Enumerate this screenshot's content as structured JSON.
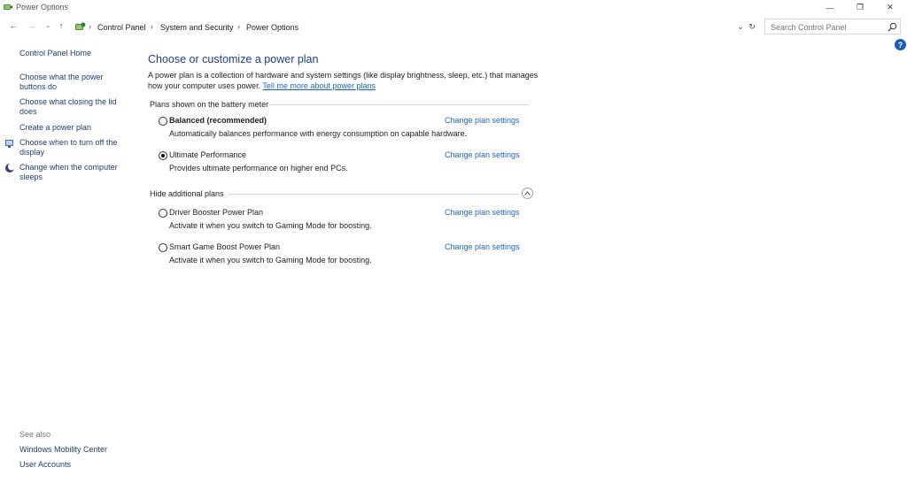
{
  "window": {
    "title": "Power Options",
    "min_glyph": "—",
    "max_glyph": "❐",
    "close_glyph": "✕"
  },
  "nav": {
    "back_glyph": "←",
    "forward_glyph": "→",
    "recent_glyph": "⌄",
    "up_glyph": "↑"
  },
  "breadcrumb": {
    "items": [
      "Control Panel",
      "System and Security",
      "Power Options"
    ],
    "separator": "›",
    "dropdown_glyph": "⌄",
    "refresh_glyph": "↻"
  },
  "search": {
    "placeholder": "Search Control Panel"
  },
  "help": {
    "glyph": "?"
  },
  "sidebar": {
    "home": "Control Panel Home",
    "links": [
      {
        "label": "Choose what the power buttons do",
        "icon": "none"
      },
      {
        "label": "Choose what closing the lid does",
        "icon": "none"
      },
      {
        "label": "Create a power plan",
        "icon": "none"
      },
      {
        "label": "Choose when to turn off the display",
        "icon": "monitor-shield-icon"
      },
      {
        "label": "Change when the computer sleeps",
        "icon": "moon-icon"
      }
    ],
    "see_also_heading": "See also",
    "see_also": [
      "Windows Mobility Center",
      "User Accounts"
    ]
  },
  "main": {
    "title": "Choose or customize a power plan",
    "description": "A power plan is a collection of hardware and system settings (like display brightness, sleep, etc.) that manages how your computer uses power.",
    "learn_more": "Tell me more about power plans",
    "section_battery": "Plans shown on the battery meter",
    "section_additional": "Hide additional plans",
    "plans": [
      {
        "name": "Balanced (recommended)",
        "description": "Automatically balances performance with energy consumption on capable hardware.",
        "selected": false,
        "bold": true,
        "link": "Change plan settings"
      },
      {
        "name": "Ultimate Performance",
        "description": "Provides ultimate performance on higher end PCs.",
        "selected": true,
        "bold": false,
        "link": "Change plan settings"
      }
    ],
    "additional_plans": [
      {
        "name": "Driver Booster Power Plan",
        "description": "Activate it when you switch to Gaming Mode for boosting.",
        "selected": false,
        "link": "Change plan settings"
      },
      {
        "name": "Smart Game Boost Power Plan",
        "description": "Activate it when you switch to Gaming Mode for boosting.",
        "selected": false,
        "link": "Change plan settings"
      }
    ]
  },
  "colors": {
    "link": "#1a66c2",
    "heading": "#1e3f87",
    "sidebar_link": "#1e3f74",
    "help_badge": "#1a5fb4"
  }
}
